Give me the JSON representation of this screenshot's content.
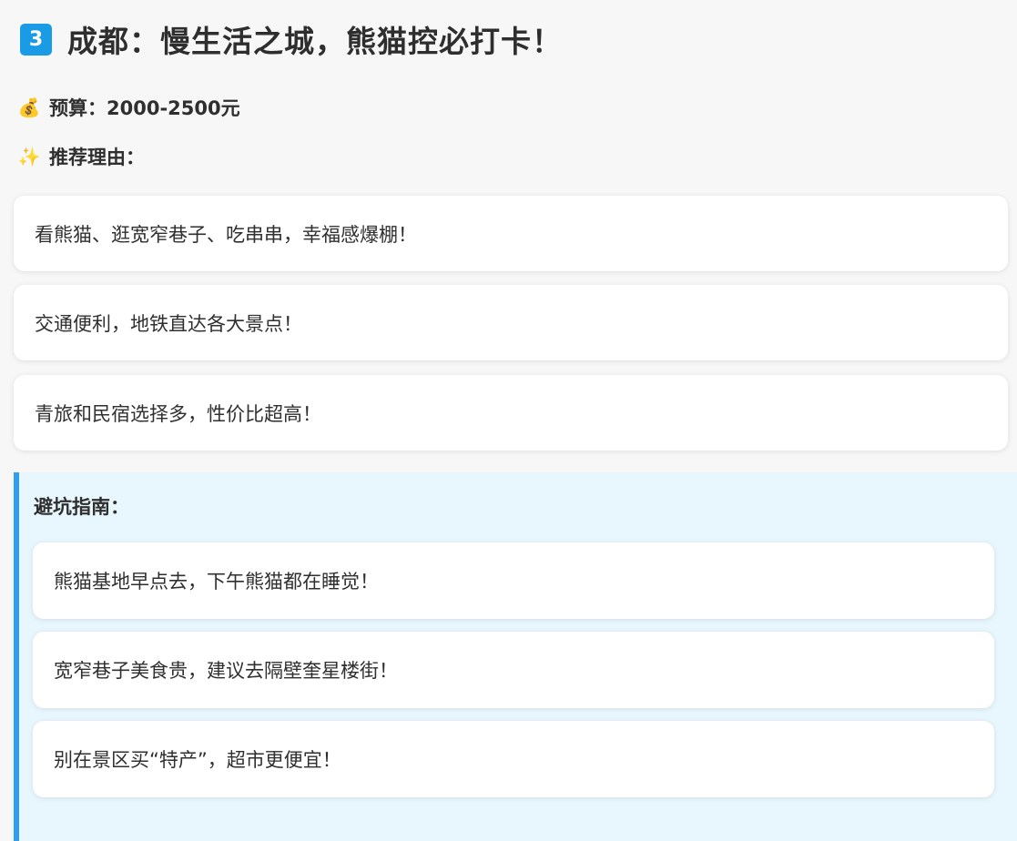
{
  "title": {
    "number": "3",
    "text": "成都：慢生活之城，熊猫控必打卡！"
  },
  "budget": {
    "icon": "money-bag-icon",
    "emoji": "💰",
    "text": "预算：2000-2500元"
  },
  "reasons": {
    "icon": "sparkles-icon",
    "emoji": "✨",
    "label": "推荐理由：",
    "items": [
      "看熊猫、逛宽窄巷子、吃串串，幸福感爆棚！",
      "交通便利，地铁直达各大景点！",
      "青旅和民宿选择多，性价比超高！"
    ]
  },
  "guide": {
    "label": "避坑指南：",
    "items": [
      "熊猫基地早点去，下午熊猫都在睡觉！",
      "宽窄巷子美食贵，建议去隔壁奎星楼街！",
      "别在景区买“特产”，超市更便宜！"
    ]
  },
  "colors": {
    "badge": "#1a9be6",
    "guide_background": "#e8f6fe",
    "guide_border": "#2e9df4",
    "page_background": "#f7f7f7"
  }
}
